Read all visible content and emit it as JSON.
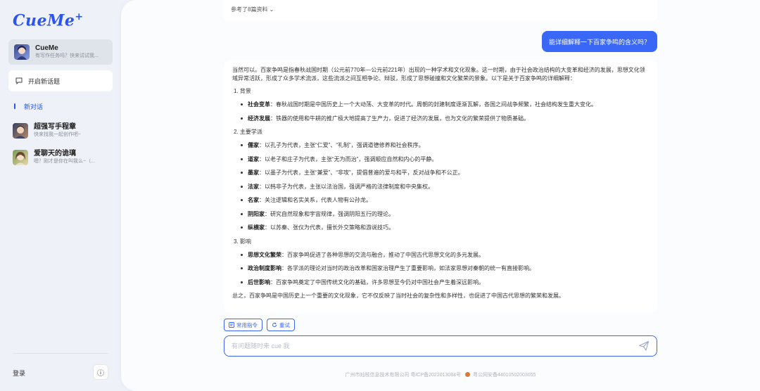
{
  "app": {
    "logo_text": "CueMe",
    "logo_plus": "+"
  },
  "sidebar": {
    "assistant": {
      "name": "CueMe",
      "desc": "有写作任务吗？快来试试我..."
    },
    "new_topic_label": "开启新话题",
    "new_chat_label": "新对话",
    "conversations": [
      {
        "title": "超强写手程章",
        "desc": "快来找我一起创作吧~"
      },
      {
        "title": "爱聊天的诡璃",
        "desc": "嗯？刚才是你在叫我么~（..."
      }
    ],
    "login_label": "登录",
    "info_glyph": "ⓘ"
  },
  "chat": {
    "top_strip_text": "参考了8篇资料  ⌄",
    "user_message": "能详细解释一下百家争鸣的含义吗？",
    "answer": {
      "intro": "当然可以。百家争鸣是指春秋战国时期（公元前770年—公元前221年）出现的一种学术和文化现象。这一时期，由于社会政治结构的大变革和经济的发展，思想文化领域异常活跃，形成了众多学术流派，这些流派之间互相争论、辩驳，形成了思想碰撞和文化繁荣的景象。以下是关于百家争鸣的详细解释：",
      "sections": [
        {
          "title": "1. 背景",
          "items": [
            {
              "term": "社会变革",
              "text": "：春秋战国时期是中国历史上一个大动荡、大变革的时代。周朝的封建制度逐渐瓦解，各国之间战争频繁，社会结构发生重大变化。"
            },
            {
              "term": "经济发展",
              "text": "：铁器的使用和牛耕的推广极大地提高了生产力，促进了经济的发展，也为文化的繁荣提供了物质基础。"
            }
          ]
        },
        {
          "title": "2. 主要学派",
          "items": [
            {
              "term": "儒家",
              "text": "：以孔子为代表，主张“仁爱”、“礼制”，强调道德修养和社会秩序。"
            },
            {
              "term": "道家",
              "text": "：以老子和庄子为代表，主张“无为而治”，强调顺应自然和内心的平静。"
            },
            {
              "term": "墨家",
              "text": "：以墨子为代表，主张“兼爱”、“非攻”，提倡普遍的爱与和平，反对战争和不公正。"
            },
            {
              "term": "法家",
              "text": "：以韩非子为代表，主张以法治国，强调严格的法律制度和中央集权。"
            },
            {
              "term": "名家",
              "text": "：关注逻辑和名实关系，代表人物有公孙龙。"
            },
            {
              "term": "阴阳家",
              "text": "：研究自然现象和宇宙规律，强调阴阳五行的理论。"
            },
            {
              "term": "纵横家",
              "text": "：以苏秦、张仪为代表，擅长外交策略和游说技巧。"
            }
          ]
        },
        {
          "title": "3. 影响",
          "items": [
            {
              "term": "思想文化繁荣",
              "text": "：百家争鸣促进了各种思想的交流与融合，推动了中国古代思想文化的多元发展。"
            },
            {
              "term": "政治制度影响",
              "text": "：各学派的理论对当时的政治改革和国家治理产生了重要影响，如法家思想对秦朝的统一有直接影响。"
            },
            {
              "term": "后世影响",
              "text": "：百家争鸣奠定了中国传统文化的基础，许多思想至今仍对中国社会产生着深远影响。"
            }
          ]
        }
      ],
      "summary": "总之，百家争鸣是中国历史上一个重要的文化现象，它不仅反映了当时社会的复杂性和多样性，也促进了中国古代思想的繁荣和发展。"
    },
    "common_commands_label": "常用指令",
    "retry_label": "重试",
    "input_placeholder": "有问题随时来 cue 我",
    "footer_company": "广州市灿枝信息技术有限公司  粤ICP备2022013084号",
    "footer_police": "粤公网安备44010502003055"
  },
  "colors": {
    "accent": "#3a67f5",
    "logo": "#2b54f5"
  }
}
